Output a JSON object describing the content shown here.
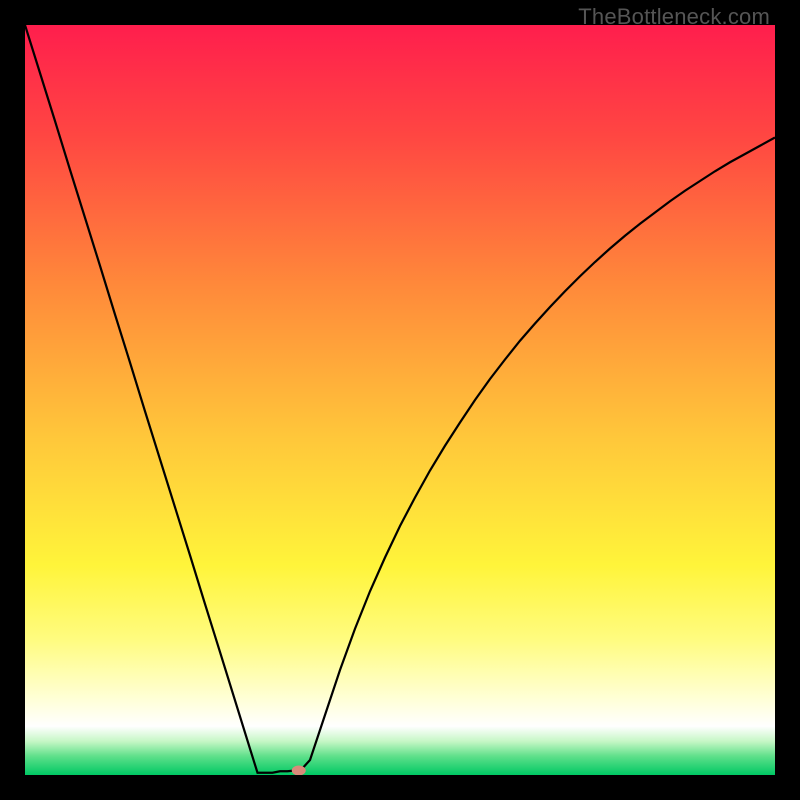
{
  "watermark": "TheBottleneck.com",
  "chart_data": {
    "type": "line",
    "title": "",
    "xlabel": "",
    "ylabel": "",
    "xlim": [
      0,
      100
    ],
    "ylim": [
      0,
      100
    ],
    "grid": false,
    "series": [
      {
        "name": "bottleneck-curve",
        "color": "#000000",
        "x": [
          0,
          2,
          4,
          6,
          8,
          10,
          12,
          14,
          16,
          18,
          20,
          22,
          24,
          26,
          28,
          30,
          31,
          32,
          33,
          34,
          35,
          36,
          37,
          38,
          40,
          42,
          44,
          46,
          48,
          50,
          52,
          54,
          56,
          58,
          60,
          62,
          64,
          66,
          68,
          70,
          72,
          74,
          76,
          78,
          80,
          82,
          84,
          86,
          88,
          90,
          92,
          94,
          96,
          98,
          100
        ],
        "values": [
          100,
          93.6,
          87.2,
          80.7,
          74.3,
          67.9,
          61.4,
          55.0,
          48.5,
          42.1,
          35.7,
          29.3,
          22.8,
          16.4,
          9.95,
          3.5,
          0.3,
          0.3,
          0.3,
          0.5,
          0.5,
          0.6,
          0.9,
          2.0,
          8.0,
          14.0,
          19.5,
          24.5,
          29.0,
          33.2,
          37.0,
          40.6,
          43.9,
          47.0,
          50.0,
          52.8,
          55.4,
          57.9,
          60.2,
          62.4,
          64.5,
          66.5,
          68.4,
          70.2,
          71.9,
          73.5,
          75.0,
          76.5,
          77.9,
          79.2,
          80.5,
          81.7,
          82.8,
          83.9,
          85.0
        ]
      }
    ],
    "marker": {
      "name": "optimal-point",
      "x": 36.5,
      "y": 0.6,
      "color": "#d98a7a"
    },
    "gradient_stops": [
      {
        "offset": 0.0,
        "color": "#ff1e4d"
      },
      {
        "offset": 0.15,
        "color": "#ff4742"
      },
      {
        "offset": 0.35,
        "color": "#ff8a3a"
      },
      {
        "offset": 0.55,
        "color": "#ffc73a"
      },
      {
        "offset": 0.72,
        "color": "#fff43a"
      },
      {
        "offset": 0.82,
        "color": "#fffc80"
      },
      {
        "offset": 0.9,
        "color": "#ffffd8"
      },
      {
        "offset": 0.935,
        "color": "#ffffff"
      },
      {
        "offset": 0.955,
        "color": "#c6f7c6"
      },
      {
        "offset": 0.975,
        "color": "#5fe08a"
      },
      {
        "offset": 1.0,
        "color": "#00c864"
      }
    ]
  }
}
